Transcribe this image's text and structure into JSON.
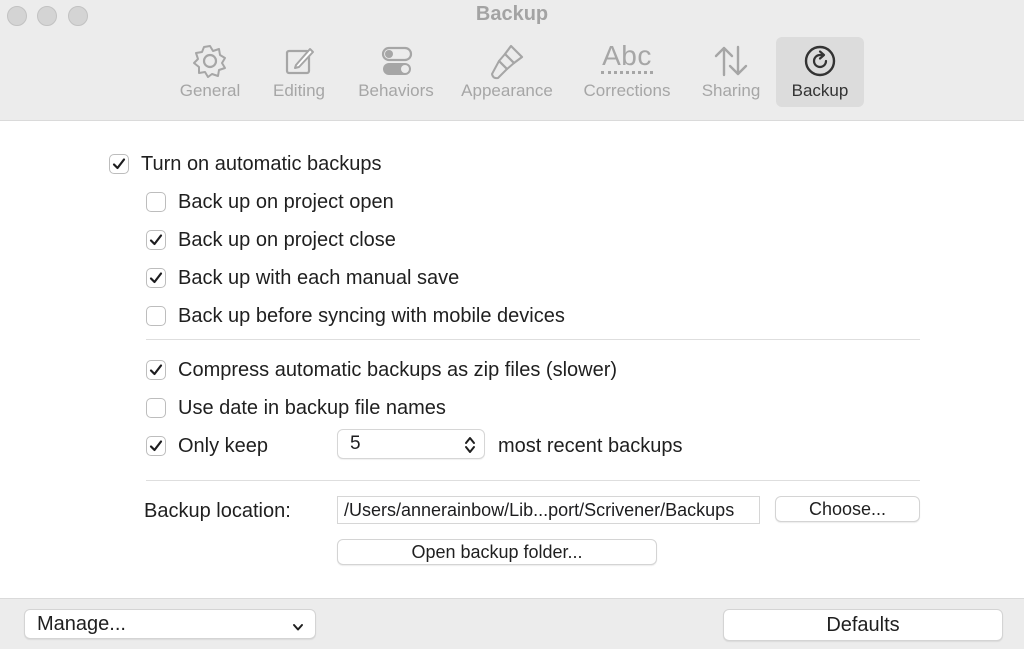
{
  "window": {
    "title": "Backup"
  },
  "toolbar": {
    "tabs": [
      {
        "label": "General",
        "icon": "gear-icon"
      },
      {
        "label": "Editing",
        "icon": "edit-icon"
      },
      {
        "label": "Behaviors",
        "icon": "toggles-icon"
      },
      {
        "label": "Appearance",
        "icon": "paintbrush-icon"
      },
      {
        "label": "Corrections",
        "icon_text": "Abc",
        "icon": "spellcheck-icon"
      },
      {
        "label": "Sharing",
        "icon": "arrows-updown-icon"
      },
      {
        "label": "Backup",
        "icon": "backup-icon",
        "active": true
      }
    ]
  },
  "options": {
    "auto_backups": {
      "label": "Turn on automatic backups",
      "checked": true
    },
    "on_open": {
      "label": "Back up on project open",
      "checked": false
    },
    "on_close": {
      "label": "Back up on project close",
      "checked": true
    },
    "manual_save": {
      "label": "Back up with each manual save",
      "checked": true
    },
    "before_sync": {
      "label": "Back up before syncing with mobile devices",
      "checked": false
    },
    "compress": {
      "label": "Compress automatic backups as zip files (slower)",
      "checked": true
    },
    "use_date": {
      "label": "Use date in backup file names",
      "checked": false
    },
    "only_keep": {
      "label": "Only keep",
      "checked": true,
      "value": "5",
      "suffix": "most recent backups"
    }
  },
  "location": {
    "label": "Backup location:",
    "path": "/Users/annerainbow/Lib...port/Scrivener/Backups",
    "choose_label": "Choose...",
    "open_folder_label": "Open backup folder..."
  },
  "footer": {
    "manage_label": "Manage...",
    "defaults_label": "Defaults"
  },
  "colors": {
    "checkmark": "#1d1d1f",
    "toolbar_bg": "#ececec",
    "active_tab_bg": "#dcdcdc"
  }
}
